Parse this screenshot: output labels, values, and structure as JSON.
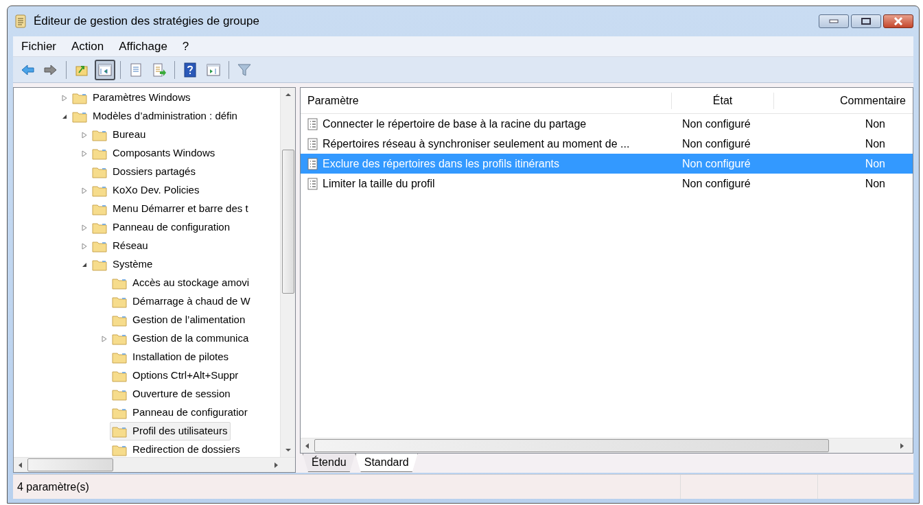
{
  "window": {
    "title": "Éditeur de gestion des stratégies de groupe"
  },
  "menu": [
    "Fichier",
    "Action",
    "Affichage",
    "?"
  ],
  "toolbar": [
    [
      {
        "kind": "back",
        "pressed": false
      },
      {
        "kind": "forward",
        "pressed": false
      }
    ],
    [
      {
        "kind": "up",
        "pressed": false
      },
      {
        "kind": "tree-toggle",
        "pressed": true
      }
    ],
    [
      {
        "kind": "properties",
        "pressed": false
      },
      {
        "kind": "export",
        "pressed": false
      }
    ],
    [
      {
        "kind": "help",
        "pressed": false
      },
      {
        "kind": "action-pane",
        "pressed": false
      }
    ],
    [
      {
        "kind": "filter",
        "pressed": false
      }
    ]
  ],
  "tree": [
    {
      "label": "Paramètres Windows",
      "expanded": false,
      "selected": false
    },
    {
      "label": "Modèles d’administration : défin",
      "expanded": true,
      "selected": false,
      "children": [
        {
          "label": "Bureau",
          "expanded": false,
          "selected": false
        },
        {
          "label": "Composants Windows",
          "expanded": false,
          "selected": false
        },
        {
          "label": "Dossiers partagés",
          "selected": false
        },
        {
          "label": "KoXo Dev. Policies",
          "expanded": false,
          "selected": false
        },
        {
          "label": "Menu Démarrer et barre des t",
          "selected": false
        },
        {
          "label": "Panneau de configuration",
          "expanded": false,
          "selected": false
        },
        {
          "label": "Réseau",
          "expanded": false,
          "selected": false
        },
        {
          "label": "Système",
          "expanded": true,
          "selected": false,
          "children": [
            {
              "label": "Accès au stockage amovi",
              "selected": false
            },
            {
              "label": "Démarrage à chaud de W",
              "selected": false
            },
            {
              "label": "Gestion de l’alimentation",
              "selected": false
            },
            {
              "label": "Gestion de la communica",
              "expanded": false,
              "selected": false
            },
            {
              "label": "Installation de pilotes",
              "selected": false
            },
            {
              "label": "Options Ctrl+Alt+Suppr",
              "selected": false
            },
            {
              "label": "Ouverture de session",
              "selected": false
            },
            {
              "label": "Panneau de configuratior",
              "selected": false
            },
            {
              "label": "Profil des utilisateurs",
              "selected": true
            },
            {
              "label": "Redirection de dossiers",
              "selected": false
            }
          ]
        }
      ]
    }
  ],
  "table": {
    "columns": [
      "Paramètre",
      "État",
      "Commentaire"
    ],
    "rows": [
      {
        "cells": [
          "Connecter le répertoire de base à la racine du partage",
          "Non configuré",
          "Non"
        ],
        "selected": false
      },
      {
        "cells": [
          "Répertoires réseau à synchroniser seulement au moment de ...",
          "Non configuré",
          "Non"
        ],
        "selected": false
      },
      {
        "cells": [
          "Exclure des répertoires dans les profils itinérants",
          "Non configuré",
          "Non"
        ],
        "selected": true
      },
      {
        "cells": [
          "Limiter la taille du profil",
          "Non configuré",
          "Non"
        ],
        "selected": false
      }
    ]
  },
  "view_tabs": [
    {
      "label": "Étendu",
      "selected": false
    },
    {
      "label": "Standard",
      "selected": true
    }
  ],
  "status_bar": "4 paramètre(s)"
}
